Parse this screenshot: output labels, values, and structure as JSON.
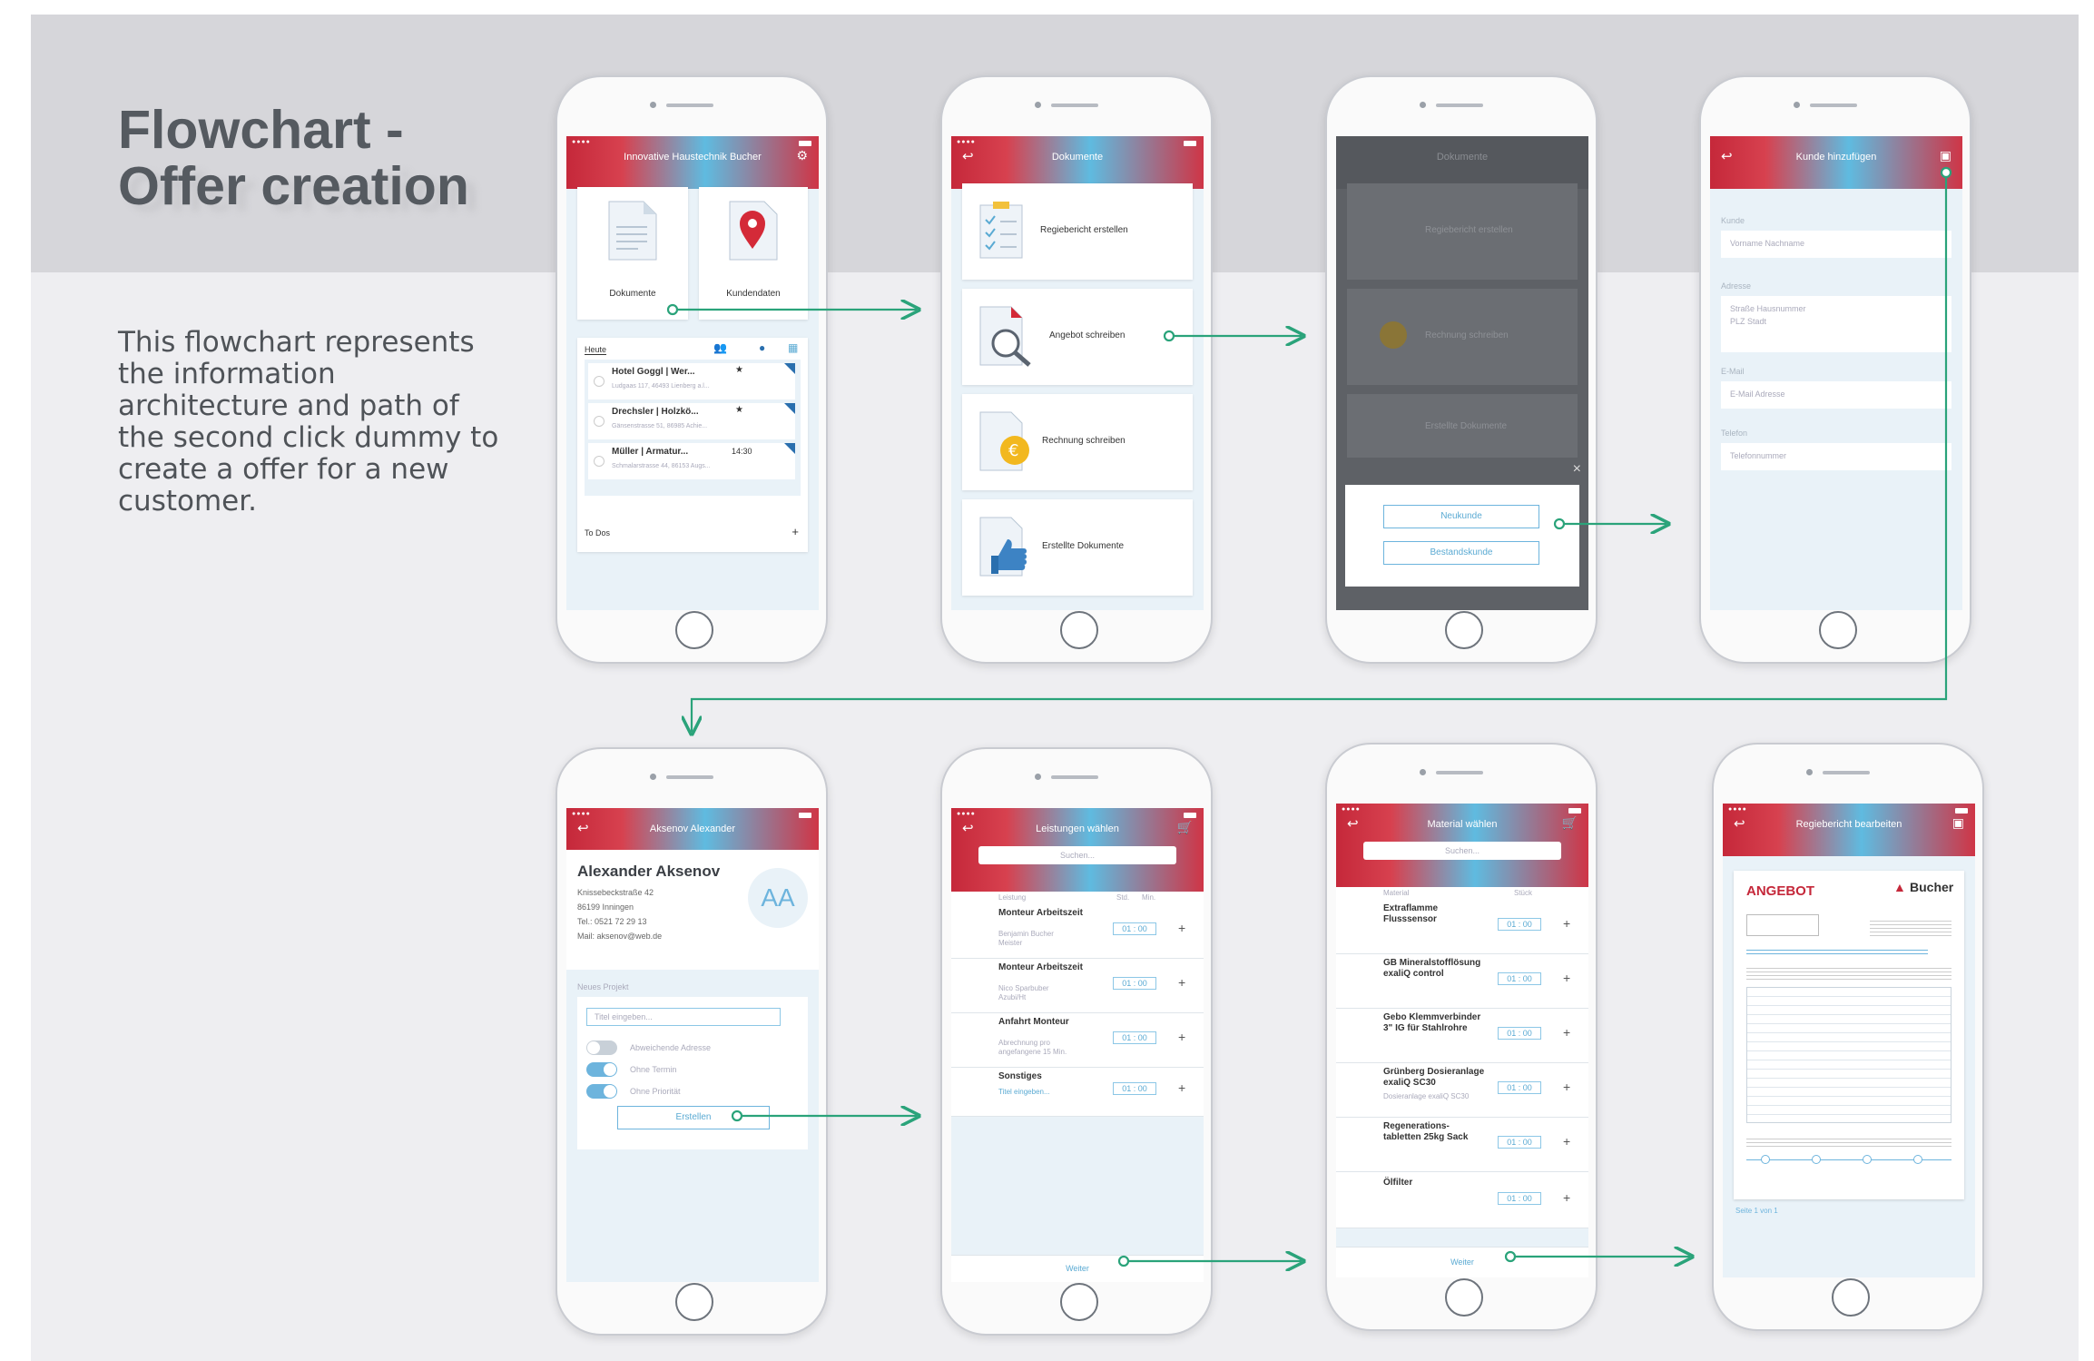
{
  "header": {
    "title_line1": "Flowchart -",
    "title_line2": "Offer creation",
    "description": "This flowchart represents the information architecture and path of the second click dummy to create a offer for a new customer."
  },
  "screens": {
    "home": {
      "title": "Innovative Haustechnik Bucher",
      "tiles": [
        "Dokumente",
        "Kundendaten"
      ],
      "tab_today": "Heute",
      "appointments": [
        {
          "name": "Hotel Goggl | Wer...",
          "sub": "Ludgaas 117, 46493 Lienberg a.l..."
        },
        {
          "name": "Drechsler | Holzkö...",
          "sub": "Gänsenstrasse 51, 86985 Achie..."
        },
        {
          "name": "Müller | Armatur...",
          "time": "14:30",
          "sub": "Schmalarstrasse 44, 86153 Augs..."
        }
      ],
      "todos": "To Dos",
      "add": "+"
    },
    "documents": {
      "title": "Dokumente",
      "items": [
        "Regiebericht erstellen",
        "Angebot schreiben",
        "Rechnung schreiben",
        "Erstellte Dokumente"
      ]
    },
    "customer_choice": {
      "title": "Dokumente",
      "items": [
        "Regiebericht erstellen",
        "Rechnung schreiben",
        "Erstellte Dokumente"
      ],
      "close": "×",
      "buttons": [
        "Neukunde",
        "Bestandskunde"
      ]
    },
    "add_customer": {
      "title": "Kunde hinzufügen",
      "fields": [
        {
          "label": "Kunde",
          "placeholder": "Vorname Nachname"
        },
        {
          "label": "Adresse",
          "placeholder": "Straße Hausnummer",
          "placeholder2": "PLZ Stadt"
        },
        {
          "label": "E-Mail",
          "placeholder": "E-Mail Adresse"
        },
        {
          "label": "Telefon",
          "placeholder": "Telefonnummer"
        }
      ]
    },
    "customer_detail": {
      "title": "Aksenov Alexander",
      "name": "Alexander Aksenov",
      "initials": "AA",
      "street": "Knissebeckstraße 42",
      "city": "86199 Inningen",
      "phone": "Tel.: 0521 72 29 13",
      "email": "Mail: aksenov@web.de",
      "new_project": "Neues Projekt",
      "title_placeholder": "Titel eingeben...",
      "toggles": [
        "Abweichende Adresse",
        "Ohne Termin",
        "Ohne Priorität"
      ],
      "create": "Erstellen"
    },
    "services": {
      "title": "Leistungen wählen",
      "search": "Suchen...",
      "col_label": "Leistung",
      "col_h": "Std.",
      "col_m": "Min.",
      "items": [
        {
          "name": "Monteur Arbeitszeit",
          "sub": "Benjamin Bucher",
          "sub2": "Meister"
        },
        {
          "name": "Monteur Arbeitszeit",
          "sub": "Nico Sparbuber",
          "sub2": "Azubi/Ht"
        },
        {
          "name": "Anfahrt Monteur",
          "sub": "Abrechnung pro",
          "sub2": "angefangene 15 Min."
        },
        {
          "name": "Sonstiges",
          "sub": "Titel eingeben..."
        }
      ],
      "value_h": "01",
      "value_m": "00",
      "next": "Weiter"
    },
    "material": {
      "title": "Material wählen",
      "search": "Suchen...",
      "col_label": "Material",
      "col_qty": "Stück",
      "items": [
        {
          "name": "Extraflamme",
          "name2": "Flusssensor"
        },
        {
          "name": "GB Mineralstofflösung",
          "name2": "exaliQ control"
        },
        {
          "name": "Gebo Klemmverbinder",
          "name2": "3\" IG für Stahlrohre"
        },
        {
          "name": "Grünberg Dosieranlage",
          "name2": "exaliQ SC30",
          "sub": "Dosieranlage exaliQ SC30"
        },
        {
          "name": "Regenerations-",
          "name2": "tabletten 25kg Sack"
        },
        {
          "name": "Ölfilter"
        }
      ],
      "value_a": "01",
      "value_b": "00",
      "next": "Weiter"
    },
    "report": {
      "title": "Regiebericht bearbeiten",
      "doc_title": "ANGEBOT",
      "brand": "Bucher",
      "page": "Seite 1 von 1"
    }
  },
  "colors": {
    "accent_red": "#c5283a",
    "accent_blue": "#5fbbe0",
    "connector": "#2aa37a"
  }
}
